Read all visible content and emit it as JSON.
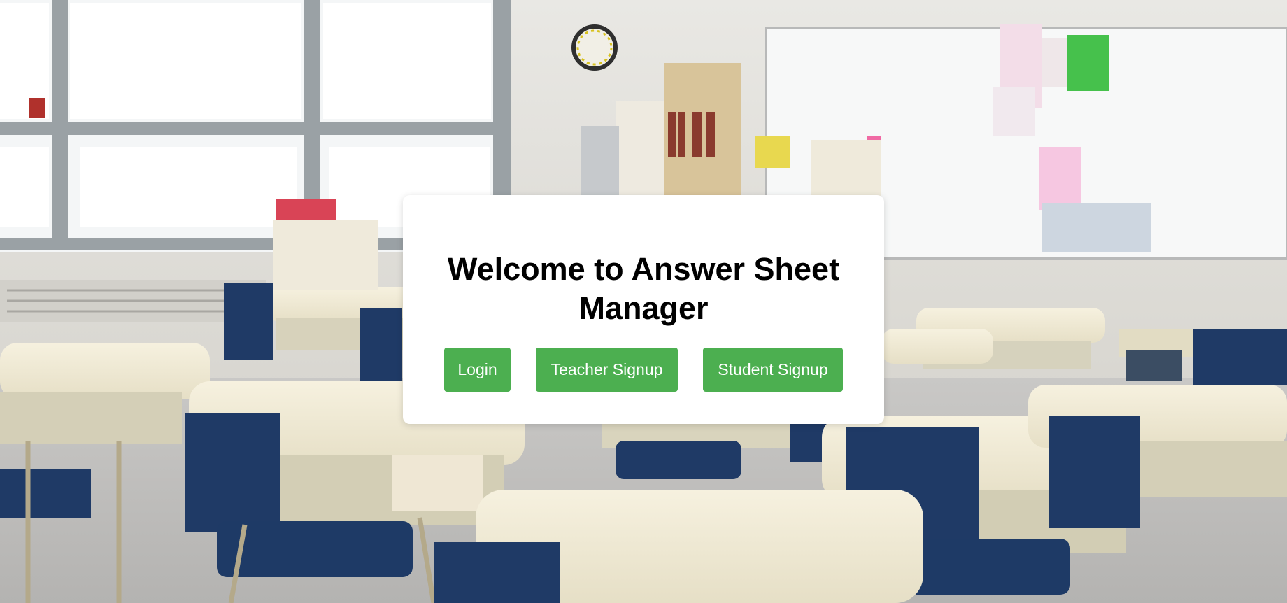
{
  "welcome": {
    "title": "Welcome to Answer Sheet Manager"
  },
  "buttons": {
    "login_label": "Login",
    "teacher_signup_label": "Teacher Signup",
    "student_signup_label": "Student Signup"
  },
  "colors": {
    "button_green": "#4caf50",
    "card_background": "#ffffff",
    "title_text": "#000000"
  },
  "background": {
    "description_icon": "classroom-photo"
  }
}
